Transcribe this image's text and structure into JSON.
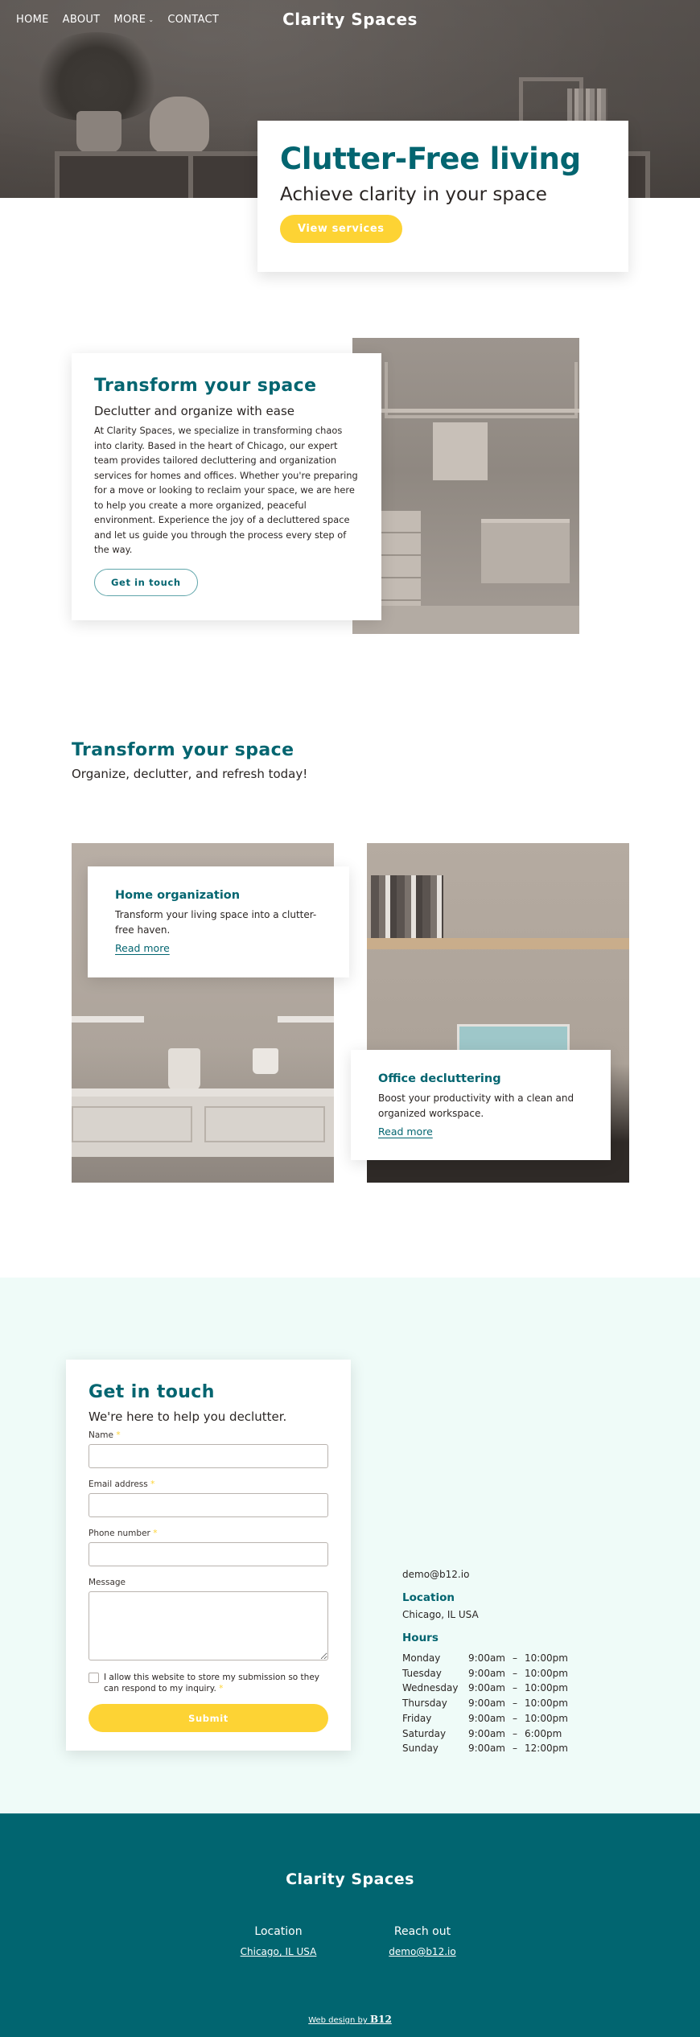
{
  "site": {
    "brand": "Clarity Spaces",
    "accent_color": "#036570",
    "button_color": "#fdd334",
    "contact_bg": "#effbf8",
    "footer_bg": "#016570"
  },
  "nav": {
    "items": [
      {
        "label": "HOME"
      },
      {
        "label": "ABOUT"
      },
      {
        "label": "MORE",
        "icon": "chevron-down-icon"
      },
      {
        "label": "CONTACT"
      }
    ],
    "chevron": "⌄"
  },
  "hero": {
    "title": "Clutter-Free living",
    "subtitle": "Achieve clarity in your space",
    "button_label": "View services"
  },
  "about": {
    "title": "Transform your space",
    "subtitle": "Declutter and organize with ease",
    "body": "At Clarity Spaces, we specialize in transforming chaos into clarity. Based in the heart of Chicago, our expert team provides tailored decluttering and organization services for homes and offices. Whether you're preparing for a move or looking to reclaim your space, we are here to help you create a more organized, peaceful environment. Experience the joy of a decluttered space and let us guide you through the process every step of the way.",
    "button_label": "Get in touch"
  },
  "services": {
    "title": "Transform your space",
    "subtitle": "Organize, declutter, and refresh today!",
    "items": [
      {
        "title": "Home organization",
        "description": "Transform your living space into a clutter-free haven.",
        "link": "Read more"
      },
      {
        "title": "Office decluttering",
        "description": "Boost your productivity with a clean and organized workspace.",
        "link": "Read more"
      }
    ]
  },
  "contact": {
    "title": "Get in touch",
    "subtitle": "We're here to help you declutter.",
    "fields": [
      {
        "label": "Name",
        "required": "*",
        "value": ""
      },
      {
        "label": "Email address",
        "required": "*",
        "value": ""
      },
      {
        "label": "Phone number",
        "required": "*",
        "value": ""
      },
      {
        "label": "Message",
        "value": ""
      }
    ],
    "consent": "I allow this website to store my submission so they can respond to my inquiry.",
    "consent_required": "*",
    "consent_checked": false,
    "submit_label": "Submit",
    "email": "demo@b12.io",
    "location_heading": "Location",
    "location": "Chicago, IL USA",
    "hours_heading": "Hours",
    "hours": [
      {
        "day": "Monday",
        "open": "9:00am",
        "sep": "–",
        "close": "10:00pm"
      },
      {
        "day": "Tuesday",
        "open": "9:00am",
        "sep": "–",
        "close": "10:00pm"
      },
      {
        "day": "Wednesday",
        "open": "9:00am",
        "sep": "–",
        "close": "10:00pm"
      },
      {
        "day": "Thursday",
        "open": "9:00am",
        "sep": "–",
        "close": "10:00pm"
      },
      {
        "day": "Friday",
        "open": "9:00am",
        "sep": "–",
        "close": "10:00pm"
      },
      {
        "day": "Saturday",
        "open": "9:00am",
        "sep": "–",
        "close": "6:00pm"
      },
      {
        "day": "Sunday",
        "open": "9:00am",
        "sep": "–",
        "close": "12:00pm"
      }
    ]
  },
  "footer": {
    "brand": "Clarity Spaces",
    "location_heading": "Location",
    "location_link": "Chicago, IL USA",
    "reach_heading": "Reach out",
    "reach_link": "demo@b12.io",
    "credit_prefix": "Web design by ",
    "credit_brand": "B12"
  }
}
